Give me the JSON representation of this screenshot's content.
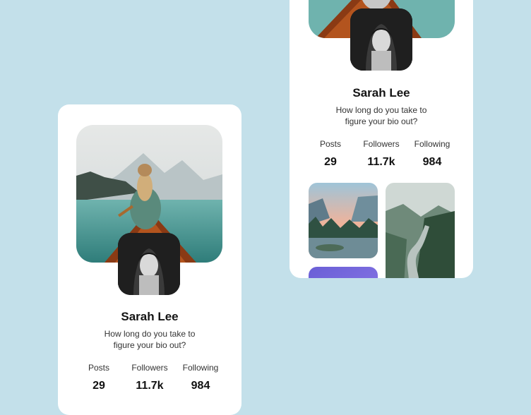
{
  "profiles": [
    {
      "name": "Sarah Lee",
      "bio_line1": "How long do you take to",
      "bio_line2": "figure your bio out?",
      "stats": [
        {
          "label": "Posts",
          "value": "29"
        },
        {
          "label": "Followers",
          "value": "11.7k"
        },
        {
          "label": "Following",
          "value": "984"
        }
      ]
    },
    {
      "name": "Sarah Lee",
      "bio_line1": "How long do you take to",
      "bio_line2": "figure your bio out?",
      "stats": [
        {
          "label": "Posts",
          "value": "29"
        },
        {
          "label": "Followers",
          "value": "11.7k"
        },
        {
          "label": "Following",
          "value": "984"
        }
      ]
    }
  ],
  "colors": {
    "background": "#c3e0ea",
    "card": "#ffffff",
    "text": "#141414"
  },
  "icons": {
    "cover": "boat-lake-photo",
    "avatar": "portrait-photo"
  }
}
